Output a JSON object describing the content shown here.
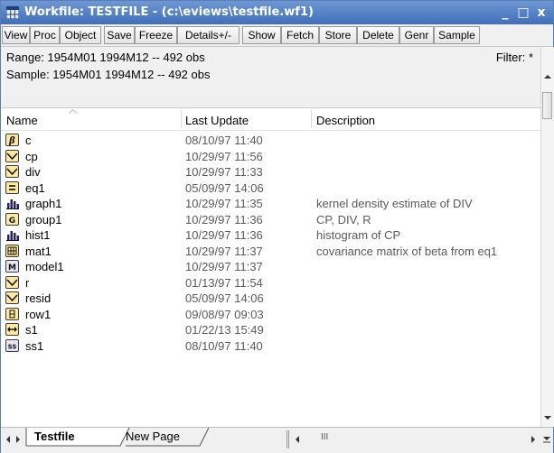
{
  "window": {
    "title": "Workfile: TESTFILE - (c:\\eviews\\testfile.wf1)",
    "controls": {
      "minimize": "_",
      "maximize": "□",
      "close": "x"
    }
  },
  "toolbar": {
    "buttons": [
      "View",
      "Proc",
      "Object",
      "Save",
      "Freeze",
      "Details+/-",
      "Show",
      "Fetch",
      "Store",
      "Delete",
      "Genr",
      "Sample"
    ]
  },
  "info": {
    "range": "Range:  1954M01 1994M12  --  492 obs",
    "sample": "Sample: 1954M01 1994M12  --  492 obs",
    "filter": "Filter: *"
  },
  "columns": {
    "name": "Name",
    "last_update": "Last Update",
    "description": "Description"
  },
  "objects": [
    {
      "name": "c",
      "date": "08/10/97  11:40",
      "desc": "",
      "icon": "coef-icon"
    },
    {
      "name": "cp",
      "date": "10/29/97  11:56",
      "desc": "",
      "icon": "series-icon"
    },
    {
      "name": "div",
      "date": "10/29/97  11:33",
      "desc": "",
      "icon": "series-icon"
    },
    {
      "name": "eq1",
      "date": "05/09/97  14:06",
      "desc": "",
      "icon": "equation-icon"
    },
    {
      "name": "graph1",
      "date": "10/29/97  11:35",
      "desc": "kernel density estimate of DIV",
      "icon": "graph-icon"
    },
    {
      "name": "group1",
      "date": "10/29/97  11:36",
      "desc": "CP, DIV, R",
      "icon": "group-icon"
    },
    {
      "name": "hist1",
      "date": "10/29/97  11:36",
      "desc": "histogram of CP",
      "icon": "graph-icon"
    },
    {
      "name": "mat1",
      "date": "10/29/97  11:37",
      "desc": "covariance matrix of beta from eq1",
      "icon": "matrix-icon"
    },
    {
      "name": "model1",
      "date": "10/29/97  11:37",
      "desc": "",
      "icon": "model-icon"
    },
    {
      "name": "r",
      "date": "01/13/97  11:54",
      "desc": "",
      "icon": "series-icon"
    },
    {
      "name": "resid",
      "date": "05/09/97  14:06",
      "desc": "",
      "icon": "series-icon"
    },
    {
      "name": "row1",
      "date": "09/08/97  09:03",
      "desc": "",
      "icon": "vector-icon"
    },
    {
      "name": "s1",
      "date": "01/22/13  15:49",
      "desc": "",
      "icon": "link-icon"
    },
    {
      "name": "ss1",
      "date": "08/10/97  11:40",
      "desc": "",
      "icon": "sspace-icon"
    }
  ],
  "tabs": {
    "active": "Testfile",
    "new": "New Page"
  },
  "hscroll": {
    "thumb_grip": "III"
  }
}
